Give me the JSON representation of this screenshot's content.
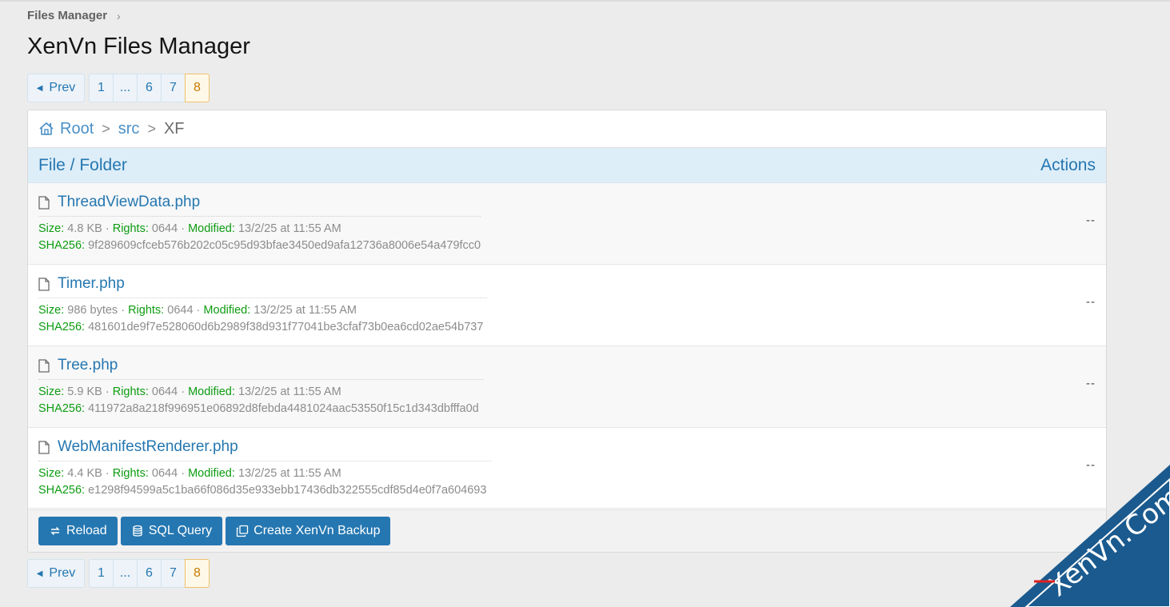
{
  "breadcrumb": {
    "label": "Files Manager",
    "chevron": "›"
  },
  "page_title": "XenVn Files Manager",
  "pagination": {
    "prev_label": "Prev",
    "pages": [
      "1",
      "...",
      "6",
      "7",
      "8"
    ],
    "current": "8"
  },
  "path": {
    "root": "Root",
    "sep": ">",
    "src": "src",
    "current": "XF"
  },
  "table": {
    "col_file": "File / Folder",
    "col_actions": "Actions"
  },
  "labels": {
    "size": "Size:",
    "rights": "Rights:",
    "modified": "Modified:",
    "sha": "SHA256:",
    "dot": "·"
  },
  "files": [
    {
      "name": "ThreadViewData.php",
      "size": "4.8 KB",
      "rights": "0644",
      "modified": "13/2/25 at 11:55 AM",
      "sha256": "9f289609cfceb576b202c05c95d93bfae3450ed9afa12736a8006e54a479fcc0",
      "action": "--"
    },
    {
      "name": "Timer.php",
      "size": "986 bytes",
      "rights": "0644",
      "modified": "13/2/25 at 11:55 AM",
      "sha256": "481601de9f7e528060d6b2989f38d931f77041be3cfaf73b0ea6cd02ae54b737",
      "action": "--"
    },
    {
      "name": "Tree.php",
      "size": "5.9 KB",
      "rights": "0644",
      "modified": "13/2/25 at 11:55 AM",
      "sha256": "411972a8a218f996951e06892d8febda4481024aac53550f15c1d343dbfffa0d",
      "action": "--"
    },
    {
      "name": "WebManifestRenderer.php",
      "size": "4.4 KB",
      "rights": "0644",
      "modified": "13/2/25 at 11:55 AM",
      "sha256": "e1298f94599a5c1ba66f086d35e933ebb17436db322555cdf85d4e0f7a604693",
      "action": "--"
    }
  ],
  "toolbar": {
    "reload": "Reload",
    "sql": "SQL Query",
    "backup": "Create XenVn Backup"
  },
  "watermark": {
    "text": "XenVn.Com",
    "color": "#1b5a8e",
    "accent": "#e02020"
  },
  "colors": {
    "link": "#2577b1",
    "key_green": "#0d9c11",
    "current_page": "#c77b00"
  }
}
